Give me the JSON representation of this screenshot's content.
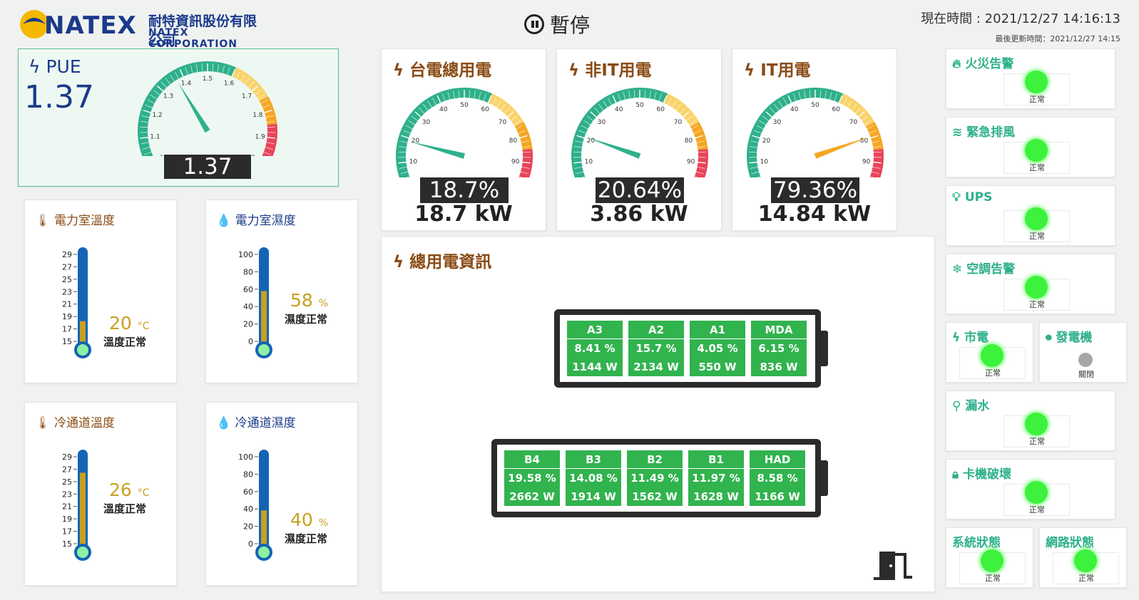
{
  "header": {
    "logo_text": "NATEX",
    "company_cn": "耐特資訊股份有限公司",
    "company_en": "NATEX CORPORATION",
    "pause_label": "暫停",
    "now_time": "現在時間 : 2021/12/27 14:16:13",
    "last_update": "最後更新時間：2021/12/27 14:15"
  },
  "pue": {
    "title": "PUE",
    "big_value": "1.37",
    "readout": "1.37",
    "value": 1.37,
    "min": 1,
    "max": 2,
    "ticks": [
      "1",
      "1.1",
      "1.2",
      "1.3",
      "1.4",
      "1.5",
      "1.6",
      "1.7",
      "1.8",
      "1.9",
      "2"
    ]
  },
  "gauges": [
    {
      "title": "台電總用電",
      "readout": "18.7%",
      "kw": "18.7 kW",
      "value": 18.7
    },
    {
      "title": "非IT用電",
      "readout": "20.64%",
      "kw": "3.86 kW",
      "value": 20.64
    },
    {
      "title": "IT用電",
      "readout": "79.36%",
      "kw": "14.84 kW",
      "value": 79.36
    }
  ],
  "gauge_ticks": [
    "0",
    "10",
    "20",
    "30",
    "40",
    "50",
    "60",
    "70",
    "80",
    "90",
    "100"
  ],
  "thermos": [
    {
      "title": "電力室溫度",
      "type": "temp",
      "value_num": "20",
      "unit": "°C",
      "status": "溫度正常",
      "fill": 0.26,
      "ticks": [
        "29",
        "27",
        "25",
        "23",
        "21",
        "19",
        "17",
        "15"
      ]
    },
    {
      "title": "電力室濕度",
      "type": "hum",
      "value_num": "58",
      "unit": "%",
      "status": "濕度正常",
      "fill": 0.58,
      "ticks": [
        "100",
        "80",
        "60",
        "40",
        "20",
        "0"
      ]
    },
    {
      "title": "冷通道溫度",
      "type": "temp",
      "value_num": "26",
      "unit": "°C",
      "status": "溫度正常",
      "fill": 0.8,
      "ticks": [
        "29",
        "27",
        "25",
        "23",
        "21",
        "19",
        "17",
        "15"
      ]
    },
    {
      "title": "冷通道濕度",
      "type": "hum",
      "value_num": "40",
      "unit": "%",
      "status": "濕度正常",
      "fill": 0.4,
      "ticks": [
        "100",
        "80",
        "60",
        "40",
        "20",
        "0"
      ]
    }
  ],
  "total": {
    "title": "總用電資訊",
    "row_a": [
      {
        "name": "A3",
        "pct": "8.41 %",
        "w": "1144 W"
      },
      {
        "name": "A2",
        "pct": "15.7 %",
        "w": "2134 W"
      },
      {
        "name": "A1",
        "pct": "4.05 %",
        "w": "550 W"
      },
      {
        "name": "MDA",
        "pct": "6.15 %",
        "w": "836 W"
      }
    ],
    "row_b": [
      {
        "name": "B4",
        "pct": "19.58 %",
        "w": "2662 W"
      },
      {
        "name": "B3",
        "pct": "14.08 %",
        "w": "1914 W"
      },
      {
        "name": "B2",
        "pct": "11.49 %",
        "w": "1562 W"
      },
      {
        "name": "B1",
        "pct": "11.97 %",
        "w": "1628 W"
      },
      {
        "name": "HAD",
        "pct": "8.58 %",
        "w": "1166 W"
      }
    ]
  },
  "alarms": {
    "fire": {
      "title": "火災告警",
      "status": "正常"
    },
    "exhaust": {
      "title": "緊急排風",
      "status": "正常"
    },
    "ups": {
      "title": "UPS",
      "status": "正常"
    },
    "ac": {
      "title": "空調告警",
      "status": "正常"
    },
    "mains": {
      "title": "市電",
      "status": "正常"
    },
    "generator": {
      "title": "發電機",
      "status": "關閉"
    },
    "leak": {
      "title": "漏水",
      "status": "正常"
    },
    "card": {
      "title": "卡機破壞",
      "status": "正常"
    },
    "system": {
      "title": "系統狀態",
      "status": "正常"
    },
    "network": {
      "title": "網路狀態",
      "status": "正常"
    }
  },
  "colors": {
    "green": "#2eb08b",
    "yellow": "#f9d36a",
    "orange": "#f5a623",
    "red": "#e8455a",
    "brand": "#1a3a8a",
    "brown": "#8a4b14"
  }
}
